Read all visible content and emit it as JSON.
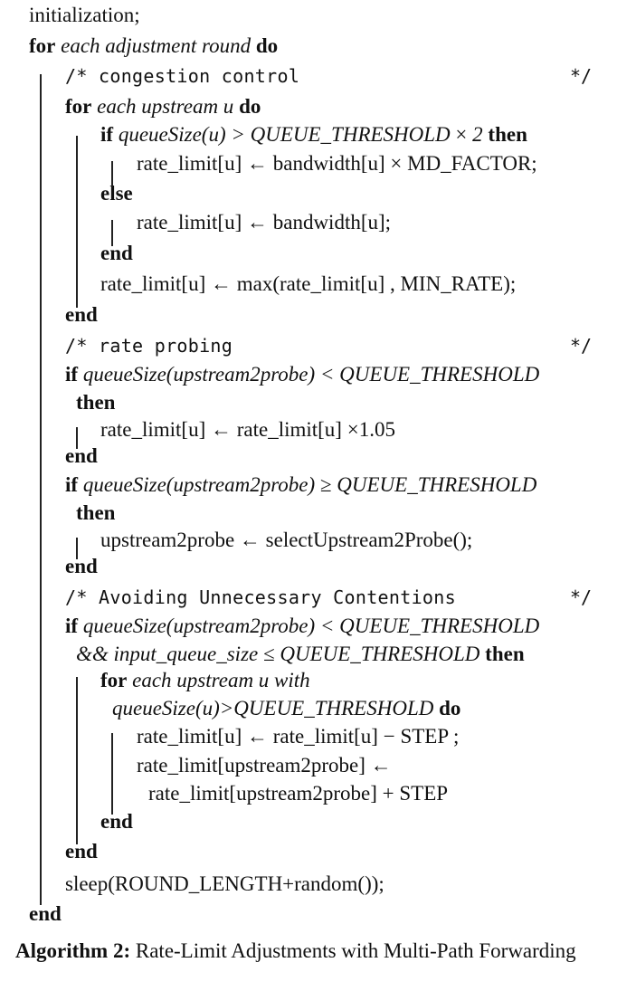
{
  "algorithm": {
    "lines": [
      {
        "parts": [
          {
            "t": "initialization;",
            "s": "n"
          }
        ]
      },
      {
        "parts": [
          {
            "t": "for",
            "s": "b"
          },
          {
            "t": " each adjustment round ",
            "s": "i"
          },
          {
            "t": "do",
            "s": "b"
          }
        ]
      },
      {
        "parts": [
          {
            "t": "/* congestion control",
            "s": "m"
          }
        ],
        "end": "*/"
      },
      {
        "parts": [
          {
            "t": "for",
            "s": "b"
          },
          {
            "t": " each upstream u ",
            "s": "i"
          },
          {
            "t": "do",
            "s": "b"
          }
        ]
      },
      {
        "parts": [
          {
            "t": "if",
            "s": "b"
          },
          {
            "t": " queueSize(u) > QUEUE_THRESHOLD",
            "s": "i"
          },
          {
            "t": " × ",
            "s": "n"
          },
          {
            "t": "2",
            "s": "i"
          },
          {
            "t": " then",
            "s": "b"
          }
        ]
      },
      {
        "parts": [
          {
            "t": "rate_limit[u] ← bandwidth[u] × MD_FACTOR;",
            "s": "n"
          }
        ]
      },
      {
        "parts": [
          {
            "t": "else",
            "s": "b"
          }
        ]
      },
      {
        "parts": [
          {
            "t": "rate_limit[u] ← bandwidth[u];",
            "s": "n"
          }
        ]
      },
      {
        "parts": [
          {
            "t": "end",
            "s": "b"
          }
        ]
      },
      {
        "parts": [
          {
            "t": "rate_limit[u] ← max(rate_limit[u] , MIN_RATE);",
            "s": "n"
          }
        ]
      },
      {
        "parts": [
          {
            "t": "end",
            "s": "b"
          }
        ]
      },
      {
        "parts": [
          {
            "t": "/* rate probing",
            "s": "m"
          }
        ],
        "end": "*/"
      },
      {
        "parts": [
          {
            "t": "if",
            "s": "b"
          },
          {
            "t": " queueSize(upstream2probe) < QUEUE_THRESHOLD",
            "s": "i"
          }
        ]
      },
      {
        "parts": [
          {
            "t": "then",
            "s": "b"
          }
        ]
      },
      {
        "parts": [
          {
            "t": "rate_limit[u] ← rate_limit[u] ×1.05",
            "s": "n"
          }
        ]
      },
      {
        "parts": [
          {
            "t": "end",
            "s": "b"
          }
        ]
      },
      {
        "parts": [
          {
            "t": "if",
            "s": "b"
          },
          {
            "t": "  queueSize(upstream2probe) ≥ QUEUE_THRESHOLD",
            "s": "i"
          }
        ]
      },
      {
        "parts": [
          {
            "t": "then",
            "s": "b"
          }
        ]
      },
      {
        "parts": [
          {
            "t": "upstream2probe ← selectUpstream2Probe();",
            "s": "n"
          }
        ]
      },
      {
        "parts": [
          {
            "t": "end",
            "s": "b"
          }
        ]
      },
      {
        "parts": [
          {
            "t": "/* Avoiding Unnecessary Contentions",
            "s": "m"
          }
        ],
        "end": "*/"
      },
      {
        "parts": [
          {
            "t": "if",
            "s": "b"
          },
          {
            "t": " queueSize(upstream2probe) < QUEUE_THRESHOLD",
            "s": "i"
          }
        ]
      },
      {
        "parts": [
          {
            "t": "&& input_queue_size ≤ QUEUE_THRESHOLD",
            "s": "i"
          },
          {
            "t": " then",
            "s": "b"
          }
        ]
      },
      {
        "parts": [
          {
            "t": "for",
            "s": "b"
          },
          {
            "t": " each upstream u with",
            "s": "i"
          }
        ]
      },
      {
        "parts": [
          {
            "t": "queueSize(u)>QUEUE_THRESHOLD",
            "s": "i"
          },
          {
            "t": " do",
            "s": "b"
          }
        ]
      },
      {
        "parts": [
          {
            "t": "rate_limit[u] ← rate_limit[u] − STEP ;",
            "s": "n"
          }
        ]
      },
      {
        "parts": [
          {
            "t": "rate_limit[upstream2probe] ←",
            "s": "n"
          }
        ]
      },
      {
        "parts": [
          {
            "t": "rate_limit[upstream2probe] + STEP",
            "s": "n"
          }
        ]
      },
      {
        "parts": [
          {
            "t": "end",
            "s": "b"
          }
        ]
      },
      {
        "parts": [
          {
            "t": "end",
            "s": "b"
          }
        ]
      },
      {
        "parts": [
          {
            "t": "sleep(ROUND_LENGTH+random());",
            "s": "n"
          }
        ]
      },
      {
        "parts": [
          {
            "t": "end",
            "s": "b"
          }
        ]
      }
    ]
  },
  "caption": {
    "label": "Algorithm 2:",
    "text": " Rate-Limit Adjustments with Multi-Path Forwarding"
  }
}
